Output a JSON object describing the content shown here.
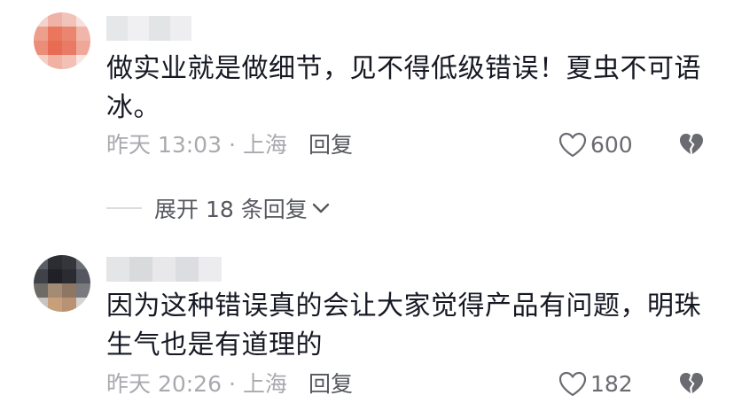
{
  "comments": [
    {
      "text": "做实业就是做细节，见不得低级错误！夏虫不可语冰。",
      "time": "昨天 13:03 · 上海",
      "reply_label": "回复",
      "likes": "600",
      "expand_label": "展开 18 条回复"
    },
    {
      "text": "因为这种错误真的会让大家觉得产品有问题，明珠生气也是有道理的",
      "time": "昨天 20:26 · 上海",
      "reply_label": "回复",
      "likes": "182"
    }
  ],
  "colors": {
    "text_primary": "#161823",
    "text_meta": "#a9aaaf",
    "text_action": "#56585f",
    "divider": "#dcdcdf"
  },
  "icons": [
    "heart-outline-icon",
    "broken-heart-icon",
    "chevron-down-icon"
  ]
}
